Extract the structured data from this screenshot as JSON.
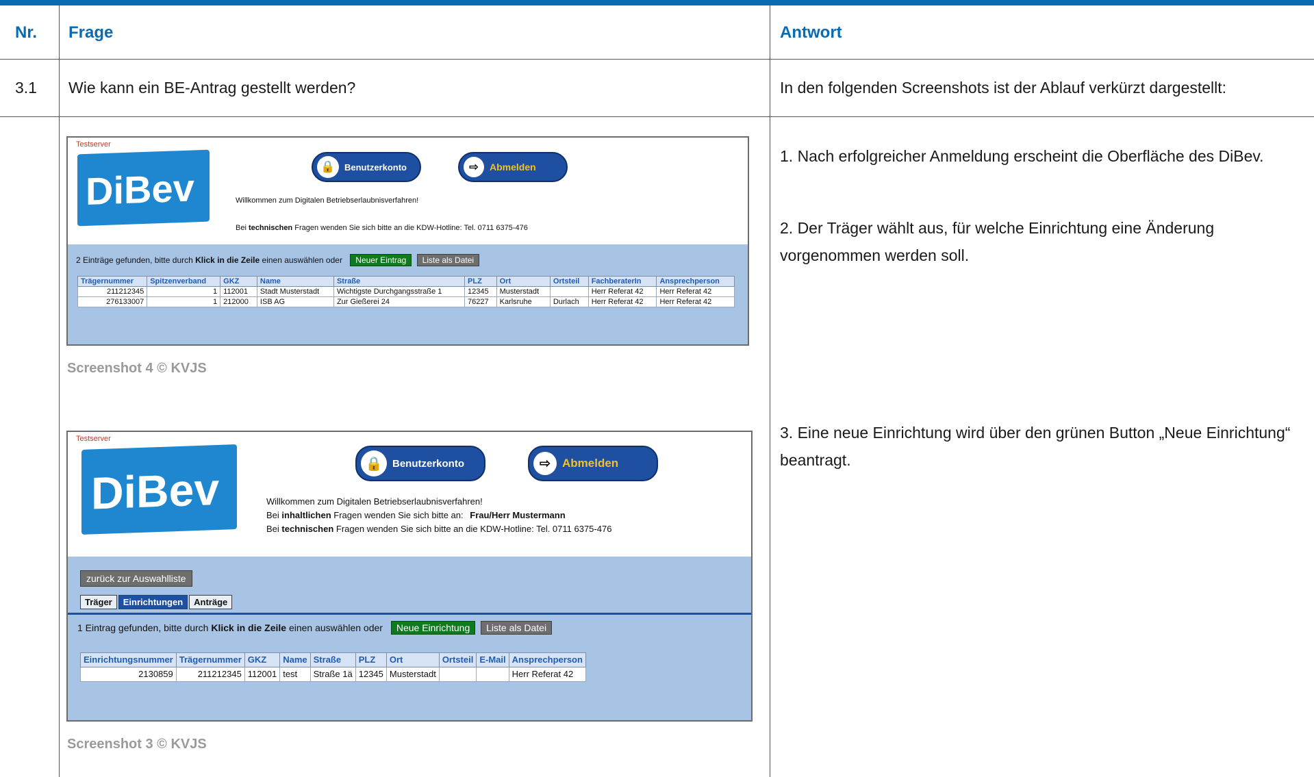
{
  "header": {
    "nr": "Nr.",
    "frage": "Frage",
    "antwort": "Antwort"
  },
  "row1": {
    "nr": "3.1",
    "frage": "Wie kann ein BE-Antrag gestellt werden?",
    "antwort": "In den folgenden Screenshots ist der Ablauf verkürzt dargestellt:"
  },
  "answers": {
    "step1": "1. Nach erfolgreicher Anmeldung erscheint die Oberfläche des DiBev.",
    "step2": "2. Der Träger wählt aus, für welche Einrichtung eine Änderung vorgenommen werden soll.",
    "step3": "3. Eine neue Einrichtung wird über den grünen Button „Neue Einrichtung“ beantragt."
  },
  "colors": {
    "accent": "#0a6bb3",
    "band": "#a8c4e4",
    "green_button": "#0e7a1e",
    "pill": "#1e4fa0"
  },
  "shot4": {
    "testserver": "Testserver",
    "logo": "DiBev",
    "btn_account": "Benutzerkonto",
    "btn_logout": "Abmelden",
    "welcome": "Willkommen zum Digitalen Betriebserlaubnisverfahren!",
    "tech_pre": "Bei",
    "tech_bold": "technischen",
    "tech_post": "Fragen wenden Sie sich bitte an die KDW-Hotline: Tel. 0711 6375-476",
    "found_pre": "2 Einträge gefunden, bitte durch",
    "found_bold": "Klick in die Zeile",
    "found_post": "einen auswählen   oder",
    "btn_new": "Neuer Eintrag",
    "btn_file": "Liste als Datei",
    "columns": [
      "Trägernummer",
      "Spitzenverband",
      "GKZ",
      "Name",
      "Straße",
      "PLZ",
      "Ort",
      "Ortsteil",
      "FachberaterIn",
      "Ansprechperson"
    ],
    "rows": [
      [
        "211212345",
        "1",
        "112001",
        "Stadt Musterstadt",
        "Wichtigste Durchgangsstraße 1",
        "12345",
        "Musterstadt",
        "",
        "Herr Referat 42",
        "Herr Referat 42"
      ],
      [
        "276133007",
        "1",
        "212000",
        "ISB AG",
        "Zur Gießerei 24",
        "76227",
        "Karlsruhe",
        "Durlach",
        "Herr Referat 42",
        "Herr Referat 42"
      ]
    ],
    "caption": "Screenshot 4 © KVJS"
  },
  "shot3": {
    "testserver": "Testserver",
    "logo": "DiBev",
    "btn_account": "Benutzerkonto",
    "btn_logout": "Abmelden",
    "welcome": "Willkommen zum Digitalen Betriebserlaubnisverfahren!",
    "content_pre": "Bei",
    "content_bold": "inhaltlichen",
    "content_post": "Fragen wenden Sie sich bitte an:",
    "contact": "Frau/Herr Mustermann",
    "tech_pre": "Bei",
    "tech_bold": "technischen",
    "tech_post": "Fragen wenden Sie sich bitte an die KDW-Hotline: Tel. 0711 6375-476",
    "back_button": "zurück zur Auswahlliste",
    "tabs": [
      "Träger",
      "Einrichtungen",
      "Anträge"
    ],
    "found_pre": "1 Eintrag gefunden, bitte durch",
    "found_bold": "Klick in die Zeile",
    "found_post": "einen auswählen   oder",
    "btn_new": "Neue Einrichtung",
    "btn_file": "Liste als Datei",
    "columns": [
      "Einrichtungsnummer",
      "Trägernummer",
      "GKZ",
      "Name",
      "Straße",
      "PLZ",
      "Ort",
      "Ortsteil",
      "E-Mail",
      "Ansprechperson"
    ],
    "rows": [
      [
        "2130859",
        "211212345",
        "112001",
        "test",
        "Straße 1ä",
        "12345",
        "Musterstadt",
        "",
        "",
        "Herr Referat 42"
      ]
    ],
    "caption": "Screenshot 3 © KVJS"
  }
}
